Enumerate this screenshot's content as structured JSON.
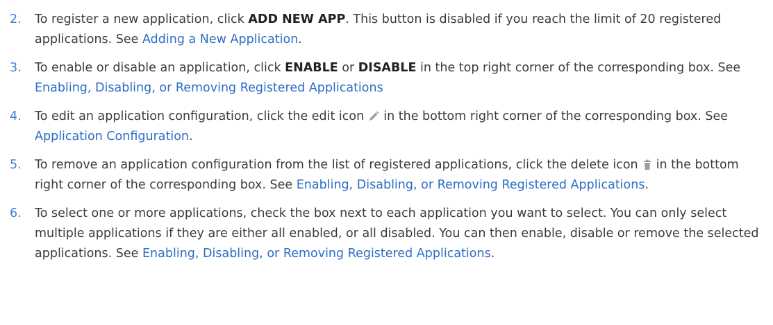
{
  "steps": [
    {
      "number": "2.",
      "pre": "To register a new application, click ",
      "bold": "ADD NEW APP",
      "post": ". This button is disabled if you reach the limit of 20 registered applications. See ",
      "link": "Adding a New Application",
      "tail": "."
    },
    {
      "number": "3.",
      "pre": "To enable or disable an application, click ",
      "bold1": "ENABLE",
      "mid": " or ",
      "bold2": "DISABLE",
      "post": " in the top right corner of the corresponding box. See ",
      "link": "Enabling, Disabling, or Removing Registered Applications"
    },
    {
      "number": "4.",
      "pre": "To edit an application configuration, click the edit icon",
      "icon": "pencil-edit-icon",
      "post": "in the bottom right corner of the corresponding box. See ",
      "link": "Application Configuration",
      "tail": "."
    },
    {
      "number": "5.",
      "pre": "To remove an application configuration from the list of registered applications, click the delete icon",
      "icon": "trash-delete-icon",
      "post": "in the bottom right corner of the corresponding box. See ",
      "link": "Enabling, Disabling, or Removing Registered Applications",
      "tail": "."
    },
    {
      "number": "6.",
      "pre": "To select one or more applications, check the box next to each application you want to select. You can only select multiple applications if they are either all enabled, or all disabled. You can then enable, disable or remove the selected applications. See ",
      "link": "Enabling, Disabling, or Removing Registered Applications",
      "tail": "."
    }
  ],
  "colors": {
    "number": "#3b7fd4",
    "link": "#2d6cc4",
    "text": "#3b3b3b",
    "icon": "#9e9e9e"
  }
}
